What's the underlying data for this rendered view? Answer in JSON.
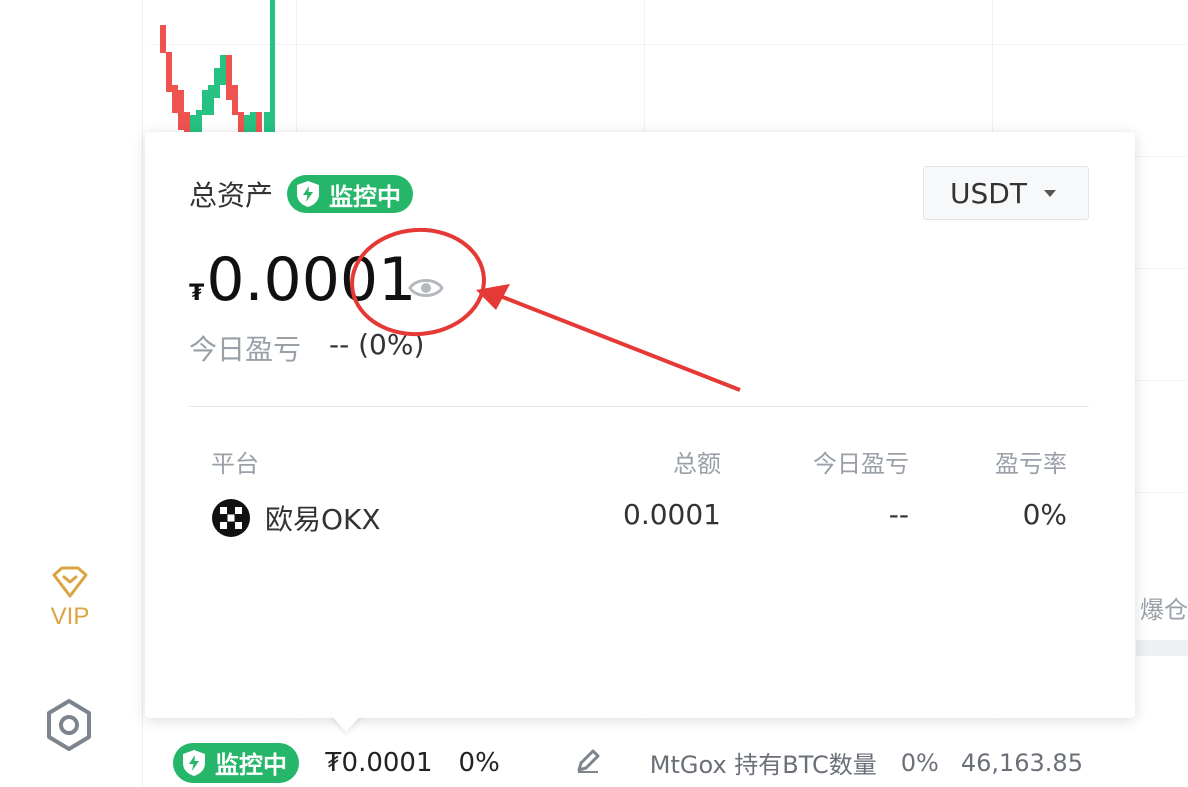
{
  "colors": {
    "accent_green": "#25b66a",
    "candle_red": "#ef5350",
    "candle_green": "#26c281",
    "vip_gold": "#d9a441",
    "annotation_red": "#e53935"
  },
  "left_nav": {
    "vip_label": "VIP",
    "vip_icon": "diamond-icon",
    "settings_icon": "hexagon-settings-icon"
  },
  "chart": {
    "right_label": "爆仓"
  },
  "card": {
    "title": "总资产",
    "badge_label": "监控中",
    "currency": "USDT",
    "amount_symbol": "₮",
    "amount": "0.0001",
    "pnl_label": "今日盈亏",
    "pnl_value": "-- (0%)",
    "table": {
      "headers": [
        "平台",
        "总额",
        "今日盈亏",
        "盈亏率"
      ],
      "rows": [
        {
          "platform": "欧易OKX",
          "total": "0.0001",
          "today_pnl": "--",
          "pnl_rate": "0%"
        }
      ]
    }
  },
  "status_bar": {
    "badge_label": "监控中",
    "amount": "₮0.0001",
    "pct": "0%",
    "ticker_label": "MtGox 持有BTC数量",
    "ticker_pct": "0%",
    "ticker_value": "46,163.85"
  }
}
